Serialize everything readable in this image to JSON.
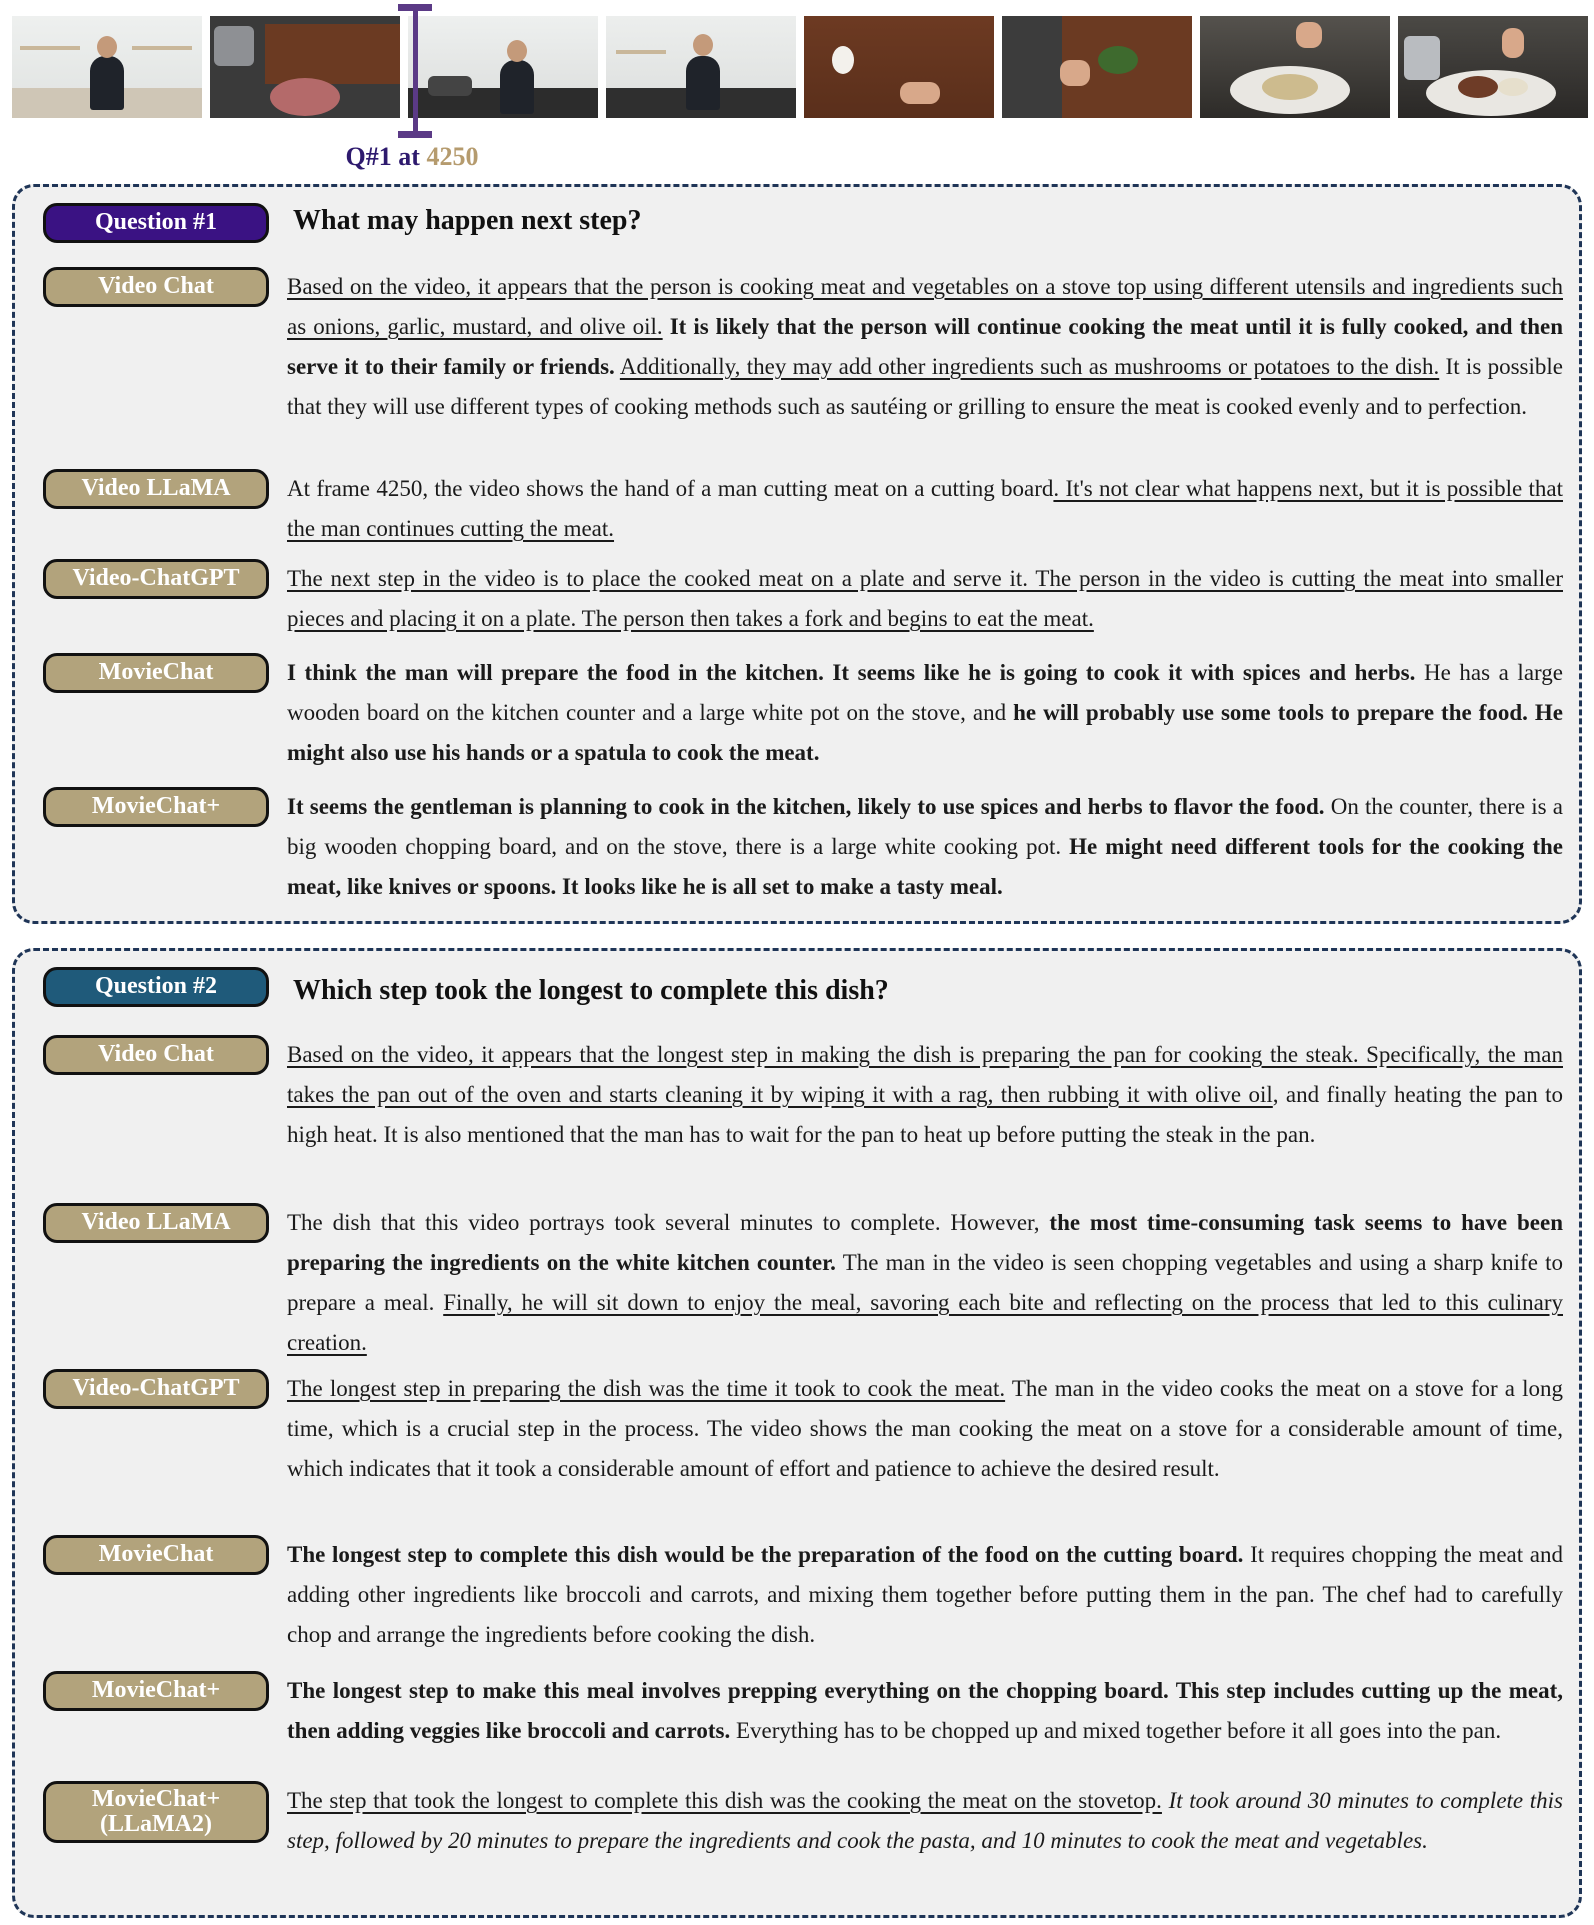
{
  "marker": {
    "label_prefix": "Q#1 at",
    "frame": "4250"
  },
  "q1": {
    "title": "Question #1",
    "question": "What may happen next step?",
    "answers": [
      {
        "model": "Video Chat",
        "segments": [
          {
            "text": "Based on the video, it appears that the person is cooking meat and vegetables on a stove top using different utensils and ingredients such as onions, garlic, mustard, and olive oil.",
            "style": "u"
          },
          {
            "text": " ",
            "style": "n"
          },
          {
            "text": "It is likely that the person will continue cooking the meat until it is fully cooked, and then serve it to their family or friends.",
            "style": "b"
          },
          {
            "text": " ",
            "style": "n"
          },
          {
            "text": "Additionally, they may add other ingredients such as mushrooms or potatoes to the dish.",
            "style": "u"
          },
          {
            "text": " It is possible that they will use different types of cooking methods such as sautéing or grilling to ensure the meat is cooked evenly and to perfection.",
            "style": "n"
          }
        ]
      },
      {
        "model": "Video LLaMA",
        "segments": [
          {
            "text": "At frame 4250, the video shows the hand of a man cutting meat on a cutting board",
            "style": "n"
          },
          {
            "text": ". It's not clear what happens next, but it is possible that the man continues cutting the meat.",
            "style": "u"
          }
        ]
      },
      {
        "model": "Video-ChatGPT",
        "segments": [
          {
            "text": "The next step in the video is to place the cooked meat on a plate and serve it. The person in the video is cutting the meat into smaller pieces and placing it on a plate. The person then takes a fork and begins to eat the meat.",
            "style": "u"
          }
        ]
      },
      {
        "model": "MovieChat",
        "segments": [
          {
            "text": "I think the man will prepare the food in the kitchen. It seems like he is going to cook it with spices and herbs.",
            "style": "b"
          },
          {
            "text": " He has a large wooden board on the kitchen counter and a large white pot on the stove, and ",
            "style": "n"
          },
          {
            "text": "he will probably use some tools to prepare the food. He might also use his hands or a spatula to cook the meat.",
            "style": "b"
          }
        ]
      },
      {
        "model": "MovieChat+",
        "segments": [
          {
            "text": "It seems the gentleman is planning to cook in the kitchen, likely to use spices and herbs to flavor the food.",
            "style": "b"
          },
          {
            "text": " On the counter, there is a big wooden chopping board, and on the stove, there is a large white cooking pot. ",
            "style": "n"
          },
          {
            "text": "He might need different tools for the cooking the meat, like knives or spoons. It looks like he is all set to make a tasty meal.",
            "style": "b"
          }
        ]
      }
    ]
  },
  "q2": {
    "title": "Question #2",
    "question": "Which step took the longest to complete this dish?",
    "answers": [
      {
        "model": "Video Chat",
        "segments": [
          {
            "text": "Based on the video, it appears that the longest step in making the dish is preparing the pan for cooking the steak. Specifically, the man takes the pan out of the oven and starts cleaning it by wiping it with a rag, then rubbing it with olive oil",
            "style": "u"
          },
          {
            "text": ", and finally heating the pan to high heat. It is also mentioned that the man has to wait for the pan to heat up before putting the steak in the pan.",
            "style": "n"
          }
        ]
      },
      {
        "model": "Video LLaMA",
        "segments": [
          {
            "text": "The dish that this video portrays took several minutes to complete. However, ",
            "style": "n"
          },
          {
            "text": "the most time-consuming task seems to have been preparing the ingredients on the white kitchen counter.",
            "style": "b"
          },
          {
            "text": " The man in the video is seen chopping vegetables and using a sharp knife to prepare a meal. ",
            "style": "n"
          },
          {
            "text": "Finally, he will sit down to enjoy the meal, savoring each bite and reflecting on the process that led to this culinary creation.",
            "style": "u"
          }
        ]
      },
      {
        "model": "Video-ChatGPT",
        "segments": [
          {
            "text": "The longest step in preparing the dish was the time it took to cook the meat.",
            "style": "u"
          },
          {
            "text": " The man in the video cooks the meat on a stove for a long time, which is a crucial step in the process. The video shows the man cooking the meat on a stove for a considerable amount of time, which indicates that it took a considerable amount of effort and patience to achieve the desired result.",
            "style": "n"
          }
        ]
      },
      {
        "model": "MovieChat",
        "segments": [
          {
            "text": "The longest step to complete this dish would be the preparation of the food on the cutting board.",
            "style": "b"
          },
          {
            "text": " It requires chopping the meat and adding other ingredients like broccoli and carrots, and mixing them together before putting them in the pan. The chef had to carefully chop and arrange the ingredients before cooking the dish.",
            "style": "n"
          }
        ]
      },
      {
        "model": "MovieChat+",
        "segments": [
          {
            "text": "The longest step to make this meal involves prepping everything on the chopping board. This step includes cutting up the meat, then adding veggies like broccoli and carrots.",
            "style": "b"
          },
          {
            "text": " Everything has to be chopped up and mixed together before it all goes into the pan.",
            "style": "n"
          }
        ]
      },
      {
        "model": "MovieChat+ (LLaMA2)",
        "segments": [
          {
            "text": "The step that took the longest to complete this dish was the cooking the meat on the stovetop.",
            "style": "u"
          },
          {
            "text": " ",
            "style": "n"
          },
          {
            "text": "It took around 30 minutes to complete this step, followed by 20 minutes to prepare the ingredients and cook the pasta, and 10 minutes to cook the meat and vegetables.",
            "style": "i"
          }
        ]
      }
    ]
  }
}
